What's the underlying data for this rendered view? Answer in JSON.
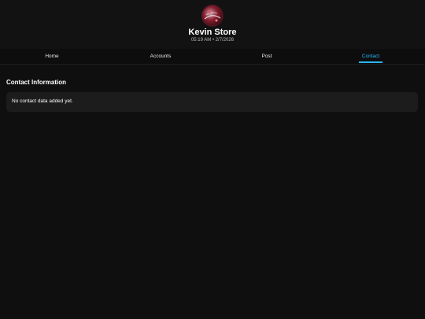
{
  "profile": {
    "name": "Kevin Store",
    "meta": "05:19 AM • 2/7/2026",
    "avatar_icon": "store-logo-avatar"
  },
  "nav": {
    "tabs": [
      {
        "label": "Home",
        "active": false
      },
      {
        "label": "Accounts",
        "active": false
      },
      {
        "label": "Post",
        "active": false
      },
      {
        "label": "Contact",
        "active": true
      }
    ]
  },
  "contact": {
    "title": "Contact Information",
    "empty_message": "No contact data added yet."
  },
  "colors": {
    "accent": "#29b6f6",
    "background": "#0f0f0f",
    "card": "#1c1c1c"
  }
}
